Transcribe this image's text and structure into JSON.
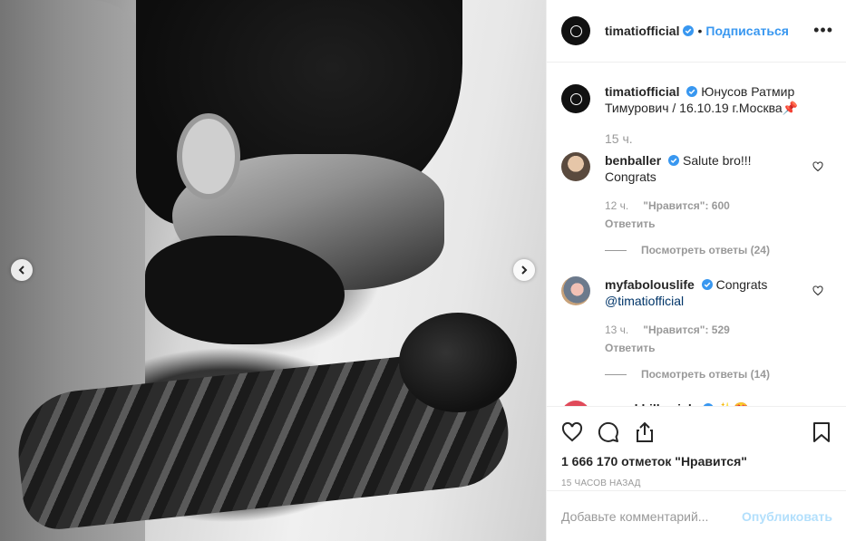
{
  "post": {
    "author": "timatiofficial",
    "follow_label": "Подписаться",
    "separator": "•",
    "more_label": "•••",
    "caption_text": "Юнусов Ратмир Тимурович / 16.10.19 г.Москва📌",
    "caption_time": "15 ч.",
    "likes_text": "1 666 170 отметок \"Нравится\"",
    "timestamp": "15 часов назад",
    "comment_placeholder": "Добавьте комментарий...",
    "publish_label": "Опубликовать"
  },
  "comments": [
    {
      "user": "benballer",
      "text": "Salute bro!!! Congrats",
      "time": "12 ч.",
      "likes": "\"Нравится\": 600",
      "reply": "Ответить",
      "view_replies": "Посмотреть ответы (24)"
    },
    {
      "user": "myfabolouslife",
      "text": "Congrats",
      "mention": "@timatiofficial",
      "time": "13 ч.",
      "likes": "\"Нравится\": 529",
      "reply": "Ответить",
      "view_replies": "Посмотреть ответы (14)"
    },
    {
      "user": "annakhilkevich",
      "text": "✨😍"
    }
  ],
  "icons": {
    "prev": "chevron-left-icon",
    "next": "chevron-right-icon",
    "like": "heart-icon",
    "comment": "comment-icon",
    "share": "share-icon",
    "save": "bookmark-icon",
    "verified": "verified-badge-icon"
  },
  "colors": {
    "accent": "#3897f0",
    "publish_disabled": "#b2dffc",
    "verified": "#3897f0",
    "muted": "#999999"
  }
}
